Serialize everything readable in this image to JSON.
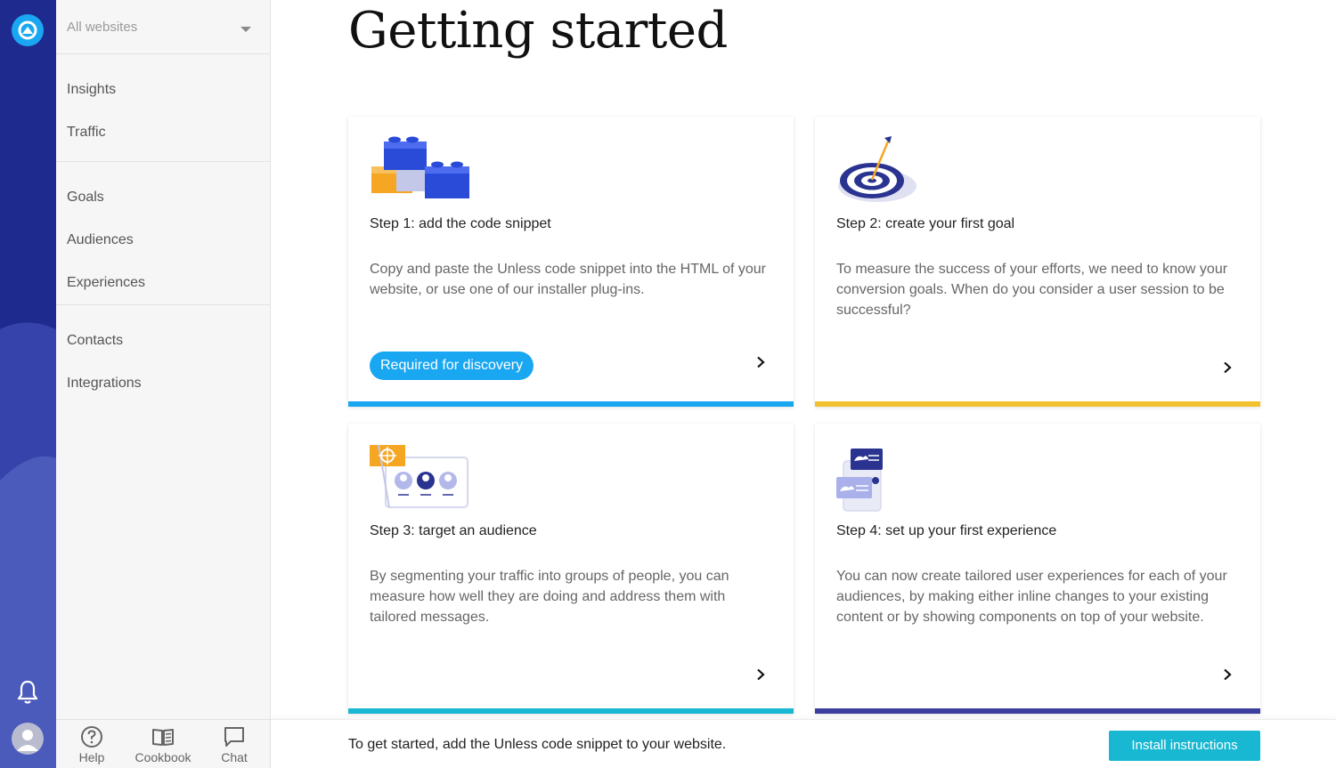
{
  "sidebar": {
    "site_select": {
      "value": "All websites"
    },
    "groups": [
      {
        "items": [
          {
            "label": "Insights"
          },
          {
            "label": "Traffic"
          }
        ]
      },
      {
        "items": [
          {
            "label": "Goals"
          },
          {
            "label": "Audiences"
          },
          {
            "label": "Experiences"
          }
        ]
      },
      {
        "items": [
          {
            "label": "Contacts"
          },
          {
            "label": "Integrations"
          }
        ]
      }
    ],
    "tools": [
      {
        "label": "Help",
        "icon": "help-circle-icon"
      },
      {
        "label": "Cookbook",
        "icon": "book-icon"
      },
      {
        "label": "Chat",
        "icon": "chat-bubble-icon"
      }
    ]
  },
  "main": {
    "title": "Getting started",
    "cards": [
      {
        "title": "Step 1: add the code snippet",
        "description": "Copy and paste the Unless code snippet into the HTML of your website, or use one of our installer plug-ins.",
        "badge": "Required for discovery",
        "bar_color": "#1aa7f2",
        "icon": "building-blocks-icon"
      },
      {
        "title": "Step 2: create your first goal",
        "description": "To measure the success of your efforts, we need to know your conversion goals. When do you consider a user session to be successful?",
        "bar_color": "#f2c12e",
        "icon": "target-arrow-icon"
      },
      {
        "title": "Step 3: target an audience",
        "description": "By segmenting your traffic into groups of people, you can measure how well they are doing and address them with tailored messages.",
        "bar_color": "#18b7d2",
        "icon": "audience-icon"
      },
      {
        "title": "Step 4: set up your first experience",
        "description": "You can now create tailored user experiences for each of your audiences, by making either inline changes to your existing content or by showing components on top of your website.",
        "bar_color": "#3c3f9e",
        "icon": "experience-icon"
      }
    ]
  },
  "footer": {
    "message": "To get started, add the Unless code snippet to your website.",
    "button": "Install instructions"
  },
  "colors": {
    "rail": "#1f2a8f",
    "accent": "#1aa7f2",
    "install_button": "#18b7d2"
  }
}
